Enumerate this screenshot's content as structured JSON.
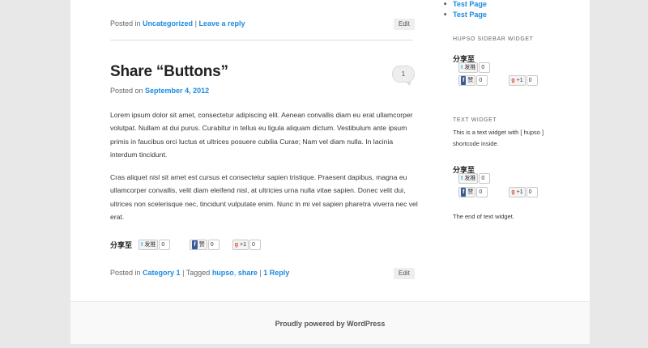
{
  "prev_post": {
    "posted_in_label": "Posted in",
    "category": "Uncategorized",
    "separator": "|",
    "leave_reply": "Leave a reply",
    "edit_label": "Edit"
  },
  "post": {
    "title": "Share “Buttons”",
    "comment_count": "1",
    "posted_on_label": "Posted on",
    "date": "September 4, 2012",
    "paragraphs": [
      "Lorem ipsum dolor sit amet, consectetur adipiscing elit. Aenean convallis diam eu erat ullamcorper volutpat. Nullam at dui purus. Curabitur in tellus eu ligula aliquam dictum. Vestibulum ante ipsum primis in faucibus orci luctus et ultrices posuere cubilia Curae; Nam vel diam nulla. In lacinia interdum tincidunt.",
      "Cras aliquet nisl sit amet est cursus et consectetur sapien tristique. Praesent dapibus, magna eu ullamcorper convallis, velit diam eleifend nisl, at ultricies urna nulla vitae sapien. Donec velit dui, ultrices non scelerisque nec, tincidunt vulputate enim. Nunc in mi vel sapien pharetra viverra nec vel erat."
    ],
    "share": {
      "label": "分享至",
      "twitter_label": "发推",
      "twitter_count": "0",
      "facebook_label": "赞",
      "facebook_count": "0",
      "gplus_label": "+1",
      "gplus_count": "0"
    },
    "footer": {
      "posted_in_label": "Posted in",
      "category": "Category 1",
      "tagged_label": "| Tagged",
      "tag1": "hupso",
      "comma": ",",
      "tag2": "share",
      "separator": "|",
      "reply_link": "1 Reply",
      "edit_label": "Edit"
    }
  },
  "sidebar": {
    "pages": [
      "Test Page",
      "Test Page"
    ],
    "hupso_widget": {
      "title": "HUPSO SIDEBAR WIDGET",
      "share_label": "分享至",
      "twitter_label": "发推",
      "twitter_count": "0",
      "facebook_label": "赞",
      "facebook_count": "0",
      "gplus_label": "+1",
      "gplus_count": "0"
    },
    "text_widget": {
      "title": "TEXT WIDGET",
      "intro": "This is a text widget with [ hupso ] shortcode inside.",
      "share_label": "分享至",
      "twitter_label": "发推",
      "twitter_count": "0",
      "facebook_label": "赞",
      "facebook_count": "0",
      "gplus_label": "+1",
      "gplus_count": "0",
      "outro": "The end of text widget."
    }
  },
  "site_footer": {
    "credit": "Proudly powered by WordPress"
  },
  "colors": {
    "link": "#1b8be0",
    "page_bg": "#e8e8e8",
    "content_bg": "#ffffff"
  }
}
